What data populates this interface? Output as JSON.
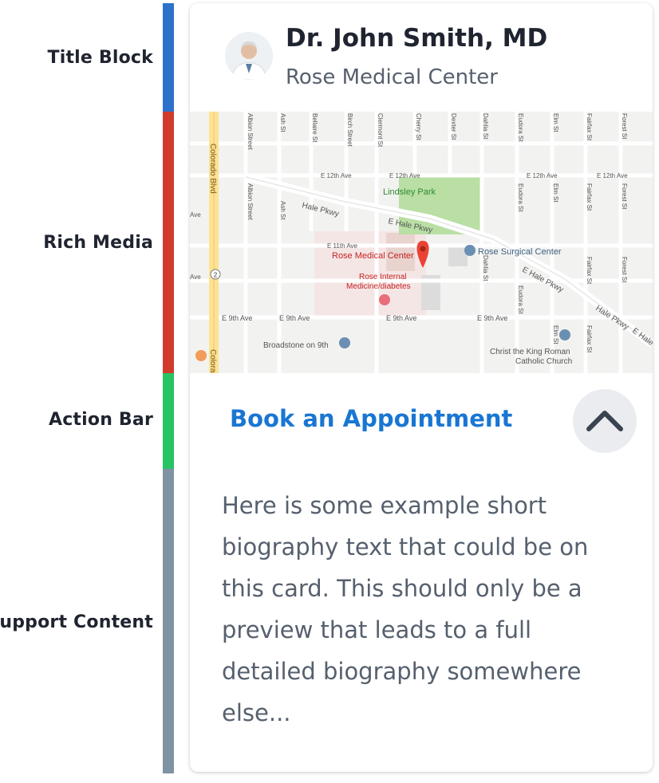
{
  "labels": {
    "title_block": "Title Block",
    "rich_media": "Rich Media",
    "action_bar": "Action Bar",
    "support_content": "Support Content"
  },
  "colors": {
    "title_block": "#2c72cc",
    "rich_media": "#d23a2c",
    "action_bar": "#27c464",
    "support_content": "#7f93a3",
    "accent": "#1976d2"
  },
  "card": {
    "doctor_name": "Dr. John Smith, MD",
    "organization": "Rose Medical Center",
    "action_label": "Book an Appointment",
    "collapse_icon": "chevron-up-icon",
    "bio": "Here is some example short biography text that could be on this card. This should only be a preview that leads to a full detailed biography somewhere else..."
  },
  "map": {
    "park": "Lindsley Park",
    "pin_label": "Rose Medical Center",
    "rose_surgical": "Rose Surgical Center",
    "rose_internal": "Rose Internal",
    "rose_internal_2": "Medicine/diabetes",
    "broadstone": "Broadstone on 9th",
    "church_1": "Christ the King Roman",
    "church_2": "Catholic Church",
    "colorado_blvd": "Colorado Blvd",
    "colorado_short": "Colora",
    "hale_pkwy": "Hale Pkwy",
    "e_hale_pkwy": "E Hale Pkwy",
    "e_hale_short": "E Hale",
    "e_11th": "E 11th Ave",
    "e_12th": "E 12th Ave",
    "e_9th": "E 9th Ave",
    "ave": "Ave",
    "albion": "Albion Street",
    "ash": "Ash St",
    "bellaire": "Bellaire St",
    "birch": "Birch Street",
    "clermont": "Clermont St",
    "cherry": "Cherry St",
    "dexter": "Dexter St",
    "dahlia": "Dahlia St",
    "eudora": "Eudora St",
    "elm": "Elm St",
    "fairfax": "Fairfax St",
    "forest": "Forest St",
    "route": "2"
  }
}
